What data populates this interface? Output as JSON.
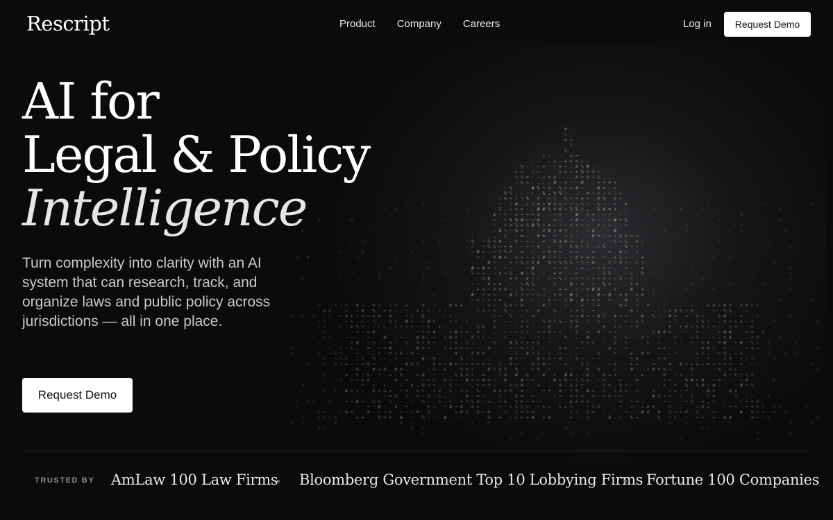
{
  "brand": {
    "name": "Rescript"
  },
  "nav": {
    "links": [
      {
        "label": "Product"
      },
      {
        "label": "Company"
      },
      {
        "label": "Careers"
      }
    ],
    "login_label": "Log in",
    "cta_label": "Request Demo"
  },
  "hero": {
    "title_line1": "AI for",
    "title_line2": "Legal & Policy",
    "title_line3": "Intelligence",
    "subtitle": "Turn complexity into clarity with an AI system that can research, track, and organize laws and public policy across jurisdictions — all in one place.",
    "cta_label": "Request Demo"
  },
  "trusted": {
    "label": "TRUSTED BY",
    "items": [
      "AmLaw 100 Law Firms",
      "Bloomberg Government Top 10 Lobbying Firms",
      "Fortune 100 Companies"
    ]
  },
  "colors": {
    "background": "#0b0b0b",
    "button_bg": "#ffffff",
    "button_text": "#111111"
  },
  "icons": {
    "hero_art": "capitol-building-ascii-art"
  }
}
